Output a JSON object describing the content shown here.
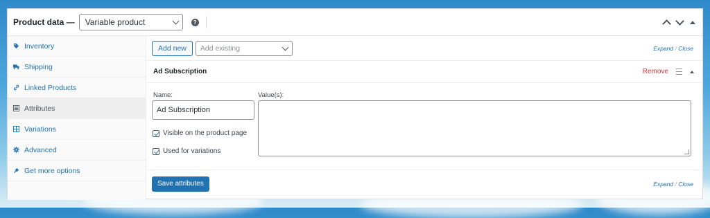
{
  "header": {
    "title": "Product data —",
    "product_type": "Variable product",
    "help_icon": "question-icon"
  },
  "sidebar": {
    "items": [
      {
        "label": "Inventory",
        "icon": "tag-icon"
      },
      {
        "label": "Shipping",
        "icon": "truck-icon"
      },
      {
        "label": "Linked Products",
        "icon": "link-icon"
      },
      {
        "label": "Attributes",
        "icon": "list-icon"
      },
      {
        "label": "Variations",
        "icon": "grid-icon"
      },
      {
        "label": "Advanced",
        "icon": "gear-icon"
      },
      {
        "label": "Get more options",
        "icon": "plug-icon"
      }
    ],
    "active": "Attributes"
  },
  "toolbar": {
    "add_new": "Add new",
    "add_existing_placeholder": "Add existing",
    "expand": "Expand",
    "sep": "/",
    "close": "Close"
  },
  "attribute": {
    "title": "Ad Subscription",
    "remove": "Remove",
    "name_label": "Name:",
    "name_value": "Ad Subscription",
    "values_label": "Value(s):",
    "visible_label": "Visible on the product page",
    "variations_label": "Used for variations"
  },
  "footer": {
    "save": "Save attributes",
    "expand": "Expand",
    "sep": "/",
    "close": "Close"
  },
  "colors": {
    "accent": "#2271b1",
    "danger": "#d63638"
  }
}
